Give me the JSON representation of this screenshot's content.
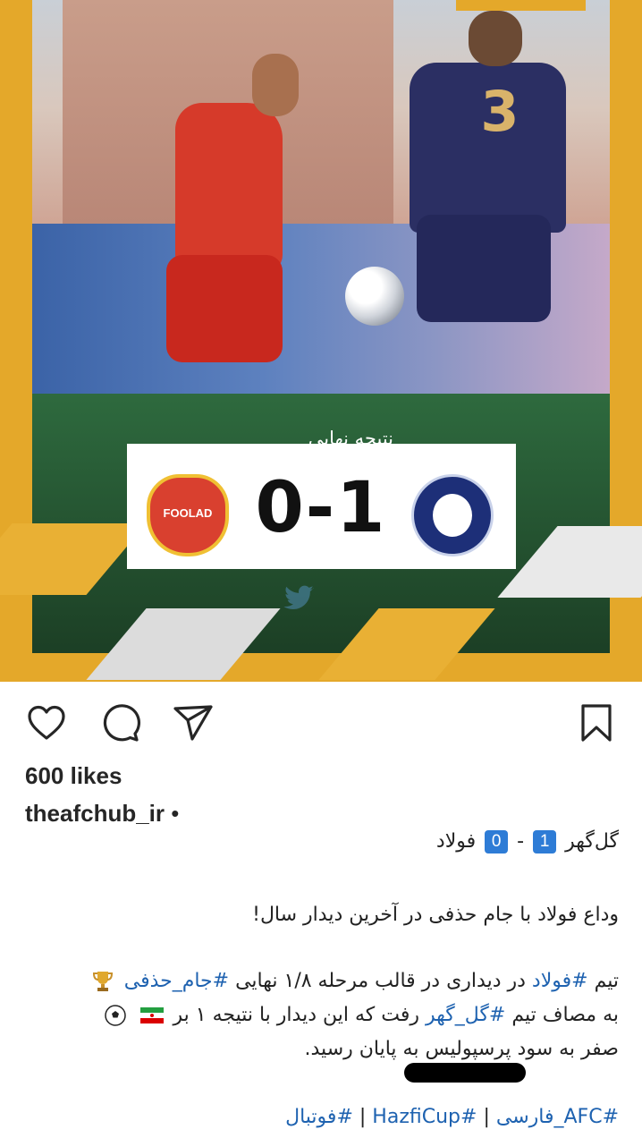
{
  "post": {
    "result_label": "نتیجه نهایی",
    "jersey_number": "3",
    "home_team_logo_text": "FOOLAD",
    "score": "0-1"
  },
  "actions": {
    "like_icon": "heart-icon",
    "comment_icon": "comment-icon",
    "share_icon": "send-icon",
    "save_icon": "bookmark-icon"
  },
  "likes": "600 likes",
  "author": {
    "username": "theafchub_ir",
    "separator": "•"
  },
  "caption": {
    "line1": {
      "team_a": "گل‌گهر",
      "score_a": "1",
      "dash": "-",
      "score_b": "0",
      "team_b": "فولاد"
    },
    "line2": "وداع فولاد با جام حذفی در آخرین دیدار سال!",
    "line3": {
      "prefix": "تیم",
      "tag1": "#فولاد",
      "middle": "در دیداری در قالب مرحله ۱/۸ نهایی",
      "tag2": "#جام_حذفی"
    },
    "line4": {
      "prefix": "به مصاف تیم",
      "tag": "#گل_گهر",
      "suffix": "رفت که  این دیدار با نتیجه ۱ بر"
    },
    "line5": "صفر به سود پرسپولیس به پایان رسید.",
    "tags_line": {
      "tag1": "#AFC_فارسی",
      "sep1": "|",
      "tag2": "#HazfiCup",
      "sep2": "|",
      "tag3": "#فوتبال"
    }
  },
  "colors": {
    "accent_yellow": "#e4a82a",
    "hashtag_blue": "#1e62b0",
    "badge_blue": "#2e7cd6"
  }
}
